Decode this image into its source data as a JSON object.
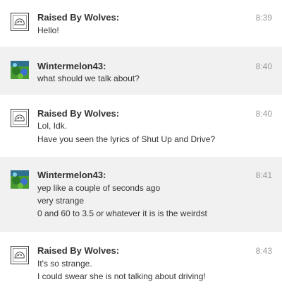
{
  "messages": [
    {
      "sender": "Raised By Wolves:",
      "avatar": "sketch-avatar",
      "time": "8:39",
      "lines": [
        "Hello!"
      ]
    },
    {
      "sender": "Wintermelon43:",
      "avatar": "wintermelon-avatar",
      "time": "8:40",
      "lines": [
        "what should we talk about?"
      ]
    },
    {
      "sender": "Raised By Wolves:",
      "avatar": "sketch-avatar",
      "time": "8:40",
      "lines": [
        "Lol, Idk.",
        "Have you seen the lyrics of Shut Up and Drive?"
      ]
    },
    {
      "sender": "Wintermelon43:",
      "avatar": "wintermelon-avatar",
      "time": "8:41",
      "lines": [
        "yep like a couple of seconds ago",
        "very strange",
        "0 and 60 to 3.5 or whatever it is is the weirdst"
      ]
    },
    {
      "sender": "Raised By Wolves:",
      "avatar": "sketch-avatar",
      "time": "8:43",
      "lines": [
        "It's so strange.",
        "I could swear she is not talking about driving!"
      ]
    }
  ]
}
